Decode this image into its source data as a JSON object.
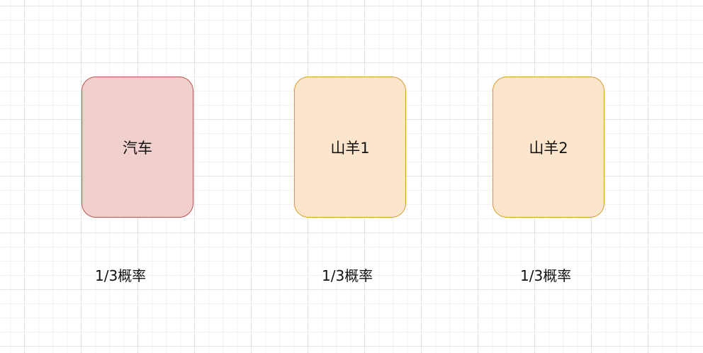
{
  "diagram": {
    "cards": [
      {
        "label": "汽车",
        "probability": "1/3概率",
        "fill": "#f0cfcd",
        "stroke": "#b85450"
      },
      {
        "label": "山羊1",
        "probability": "1/3概率",
        "fill": "#fbe6cd",
        "stroke": "#d79b2e"
      },
      {
        "label": "山羊2",
        "probability": "1/3概率",
        "fill": "#fbe6cd",
        "stroke": "#d79b2e"
      }
    ]
  }
}
